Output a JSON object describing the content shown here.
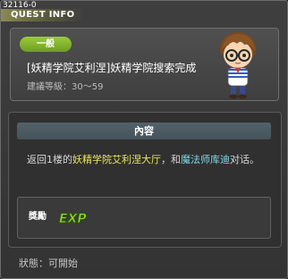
{
  "header": {
    "quest_id": "32116-0",
    "title": "QUEST INFO"
  },
  "summary": {
    "badge": "一般",
    "quest_name": "[妖精学院艾利涅]妖精学院搜索完成",
    "level_requirement": "建議等級：30～59",
    "npc_icon": "npc-portrait-icon"
  },
  "content": {
    "header": "內容",
    "segments": [
      {
        "text": "返回1楼的",
        "color": "normal"
      },
      {
        "text": "妖精学院艾利涅大厅",
        "color": "yellow"
      },
      {
        "text": "，和",
        "color": "normal"
      },
      {
        "text": "魔法师库迪",
        "color": "cyan"
      },
      {
        "text": "对话。",
        "color": "normal"
      }
    ]
  },
  "reward": {
    "label": "獎勵",
    "icon": "exp-icon",
    "icon_text": "EXP"
  },
  "status": "狀態：可開始",
  "colors": {
    "badge_green": "#8cbf34",
    "highlight_yellow": "#e6e65a",
    "highlight_cyan": "#7fd9e6",
    "exp_green": "#9ade2a"
  }
}
